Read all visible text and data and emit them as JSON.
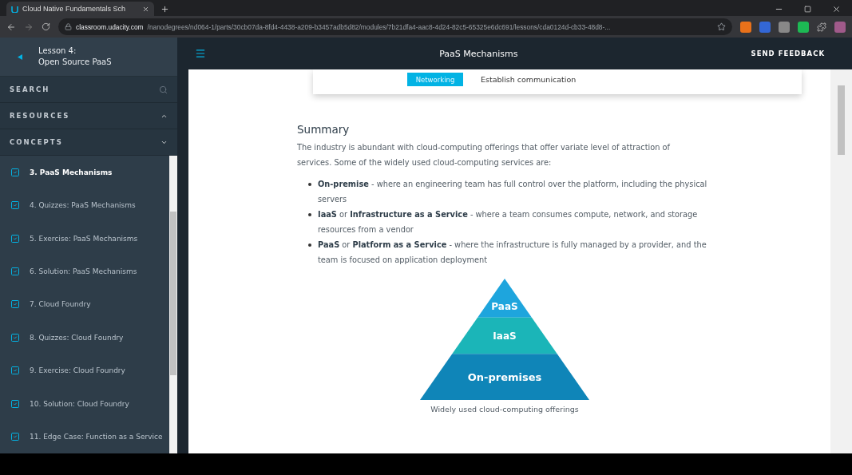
{
  "browser": {
    "tab_title": "Cloud Native Fundamentals Sch",
    "url_host": "classroom.udacity.com",
    "url_path": "/nanodegrees/nd064-1/parts/30cb07da-8fd4-4438-a209-b3457adb5d82/modules/7b21dfa4-aac8-4d24-82c5-65325e6dc691/lessons/cda0124d-cb33-48d8-..."
  },
  "sidebar": {
    "lesson_label": "Lesson 4:",
    "lesson_title": "Open Source PaaS",
    "sections": [
      {
        "label": "SEARCH",
        "kind": "search"
      },
      {
        "label": "RESOURCES",
        "kind": "collapsed"
      },
      {
        "label": "CONCEPTS",
        "kind": "expanded"
      }
    ],
    "items": [
      {
        "label": "3. PaaS Mechanisms",
        "selected": true,
        "done": true
      },
      {
        "label": "4. Quizzes: PaaS Mechanisms",
        "selected": false,
        "done": true
      },
      {
        "label": "5. Exercise: PaaS Mechanisms",
        "selected": false,
        "done": true
      },
      {
        "label": "6. Solution: PaaS Mechanisms",
        "selected": false,
        "done": true
      },
      {
        "label": "7. Cloud Foundry",
        "selected": false,
        "done": true
      },
      {
        "label": "8. Quizzes: Cloud Foundry",
        "selected": false,
        "done": true
      },
      {
        "label": "9. Exercise: Cloud Foundry",
        "selected": false,
        "done": true
      },
      {
        "label": "10. Solution: Cloud Foundry",
        "selected": false,
        "done": true
      },
      {
        "label": "11. Edge Case: Function as a Service",
        "selected": false,
        "done": true
      }
    ]
  },
  "header": {
    "title": "PaaS Mechanisms",
    "action": "SEND FEEDBACK"
  },
  "card_rows": [
    {
      "tag": "Networking",
      "text": "Establish communication"
    }
  ],
  "summary": {
    "heading": "Summary",
    "intro": "The industry is abundant with cloud-computing offerings that offer variate level of attraction of services. Some of the widely used cloud-computing services are:",
    "bullets": [
      "**On-premise** - where an engineering team has full control over the platform, including the physical servers",
      "**IaaS** or **Infrastructure as a Service** - where a team consumes compute, network, and storage resources from a vendor",
      "**PaaS** or **Platform as a Service** - where the infrastructure is fully managed by a provider, and the team is focused on application deployment"
    ]
  },
  "figure": {
    "layers": [
      {
        "label": "PaaS",
        "color": "#1ea5dd"
      },
      {
        "label": "IaaS",
        "color": "#1bb5b8"
      },
      {
        "label": "On-premises",
        "color": "#0f85b8"
      }
    ],
    "caption": "Widely used cloud-computing offerings"
  }
}
